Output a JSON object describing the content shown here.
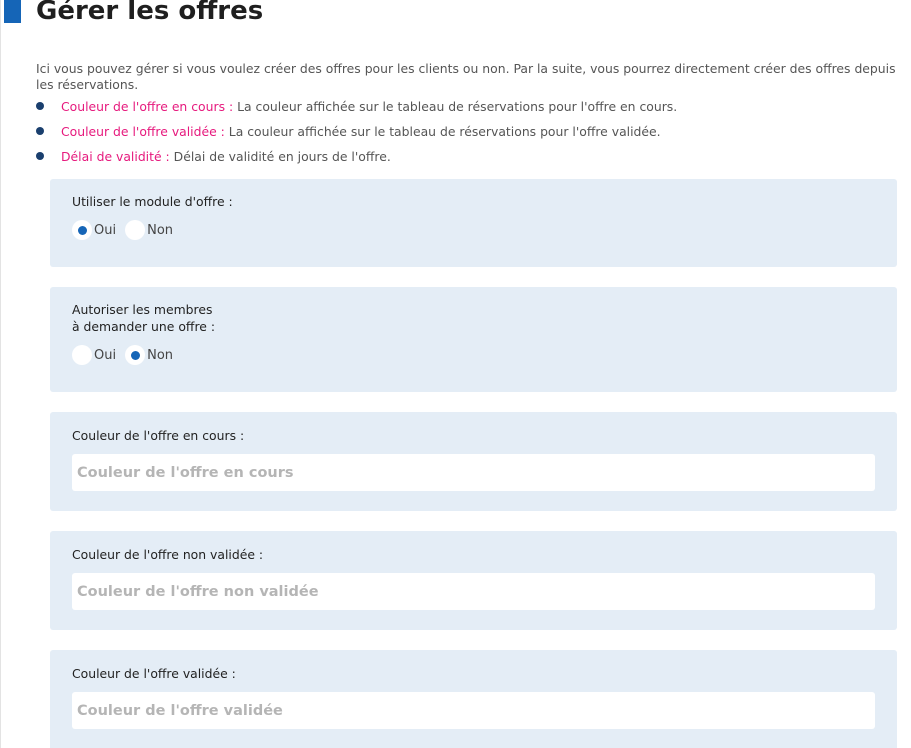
{
  "page": {
    "title": "Gérer les offres",
    "intro": "Ici vous pouvez gérer si vous voulez créer des offres pour les clients ou non. Par la suite, vous pourrez directement créer des offres depuis les réservations."
  },
  "legend": [
    {
      "term": "Couleur de l'offre en cours :",
      "description": " La couleur affichée sur le tableau de réservations pour l'offre en cours."
    },
    {
      "term": "Couleur de l'offre validée :",
      "description": " La couleur affichée sur le tableau de réservations pour l'offre validée."
    },
    {
      "term": "Délai de validité :",
      "description": " Délai de validité en jours de l'offre."
    }
  ],
  "module_offre": {
    "label": "Utiliser le module d'offre :",
    "options": [
      "Oui",
      "Non"
    ],
    "selected": "Oui"
  },
  "membres_offre": {
    "label": "Autoriser les membres\nà demander une offre :",
    "options": [
      "Oui",
      "Non"
    ],
    "selected": "Non"
  },
  "couleur_en_cours": {
    "label": "Couleur de l'offre en cours :",
    "placeholder": "Couleur de l'offre en cours",
    "value": ""
  },
  "couleur_non_validee": {
    "label": "Couleur de l'offre non validée :",
    "placeholder": "Couleur de l'offre non validée",
    "value": ""
  },
  "couleur_validee": {
    "label": "Couleur de l'offre validée :",
    "placeholder": "Couleur de l'offre validée",
    "value": ""
  },
  "colors": {
    "accent": "#1565b7",
    "term_highlight": "#e6197d",
    "card_background": "#e4edf6"
  }
}
